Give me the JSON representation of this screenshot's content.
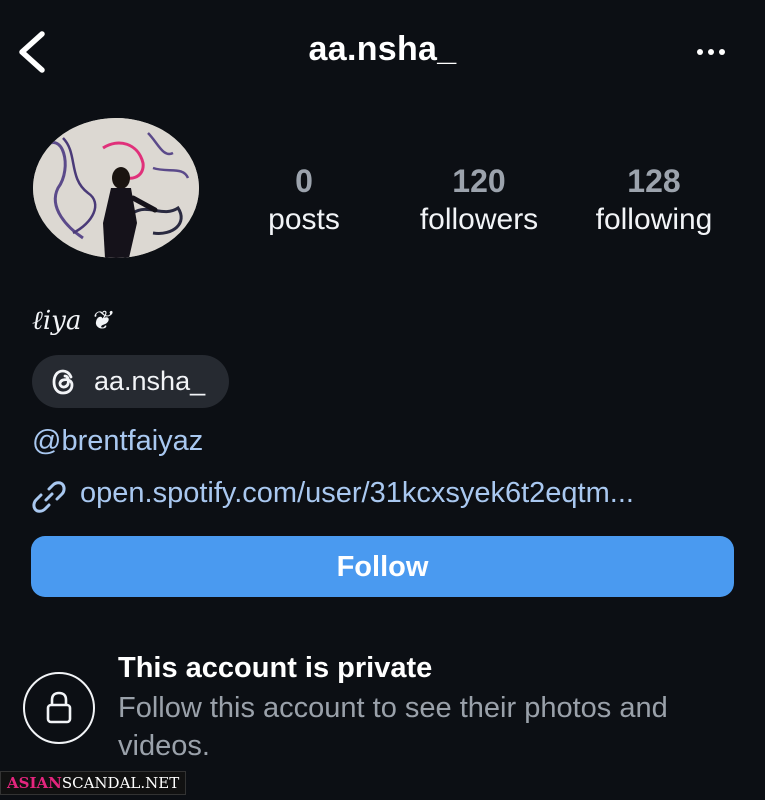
{
  "header": {
    "username": "aa.nsha_",
    "back_icon": "chevron-left-icon",
    "more_icon": "more-horizontal-icon"
  },
  "stats": {
    "posts": {
      "value": "0",
      "label": "posts"
    },
    "followers": {
      "value": "120",
      "label": "followers"
    },
    "following": {
      "value": "128",
      "label": "following"
    }
  },
  "bio": {
    "display_name": "ℓiya ❦",
    "threads_handle": "aa.nsha_",
    "mention": "@brentfaiyaz",
    "link": "open.spotify.com/user/31kcxsyek6t2eqtm..."
  },
  "actions": {
    "follow_label": "Follow",
    "follow_color": "#4a9af0"
  },
  "private_notice": {
    "title": "This account is private",
    "subtitle": "Follow this account to see their photos and videos."
  },
  "watermark": {
    "part1": "ASIAN",
    "part2": "SCANDAL.NET"
  },
  "colors": {
    "background": "#0c0f14",
    "link": "#a9c8f0",
    "chip": "#262a31"
  }
}
